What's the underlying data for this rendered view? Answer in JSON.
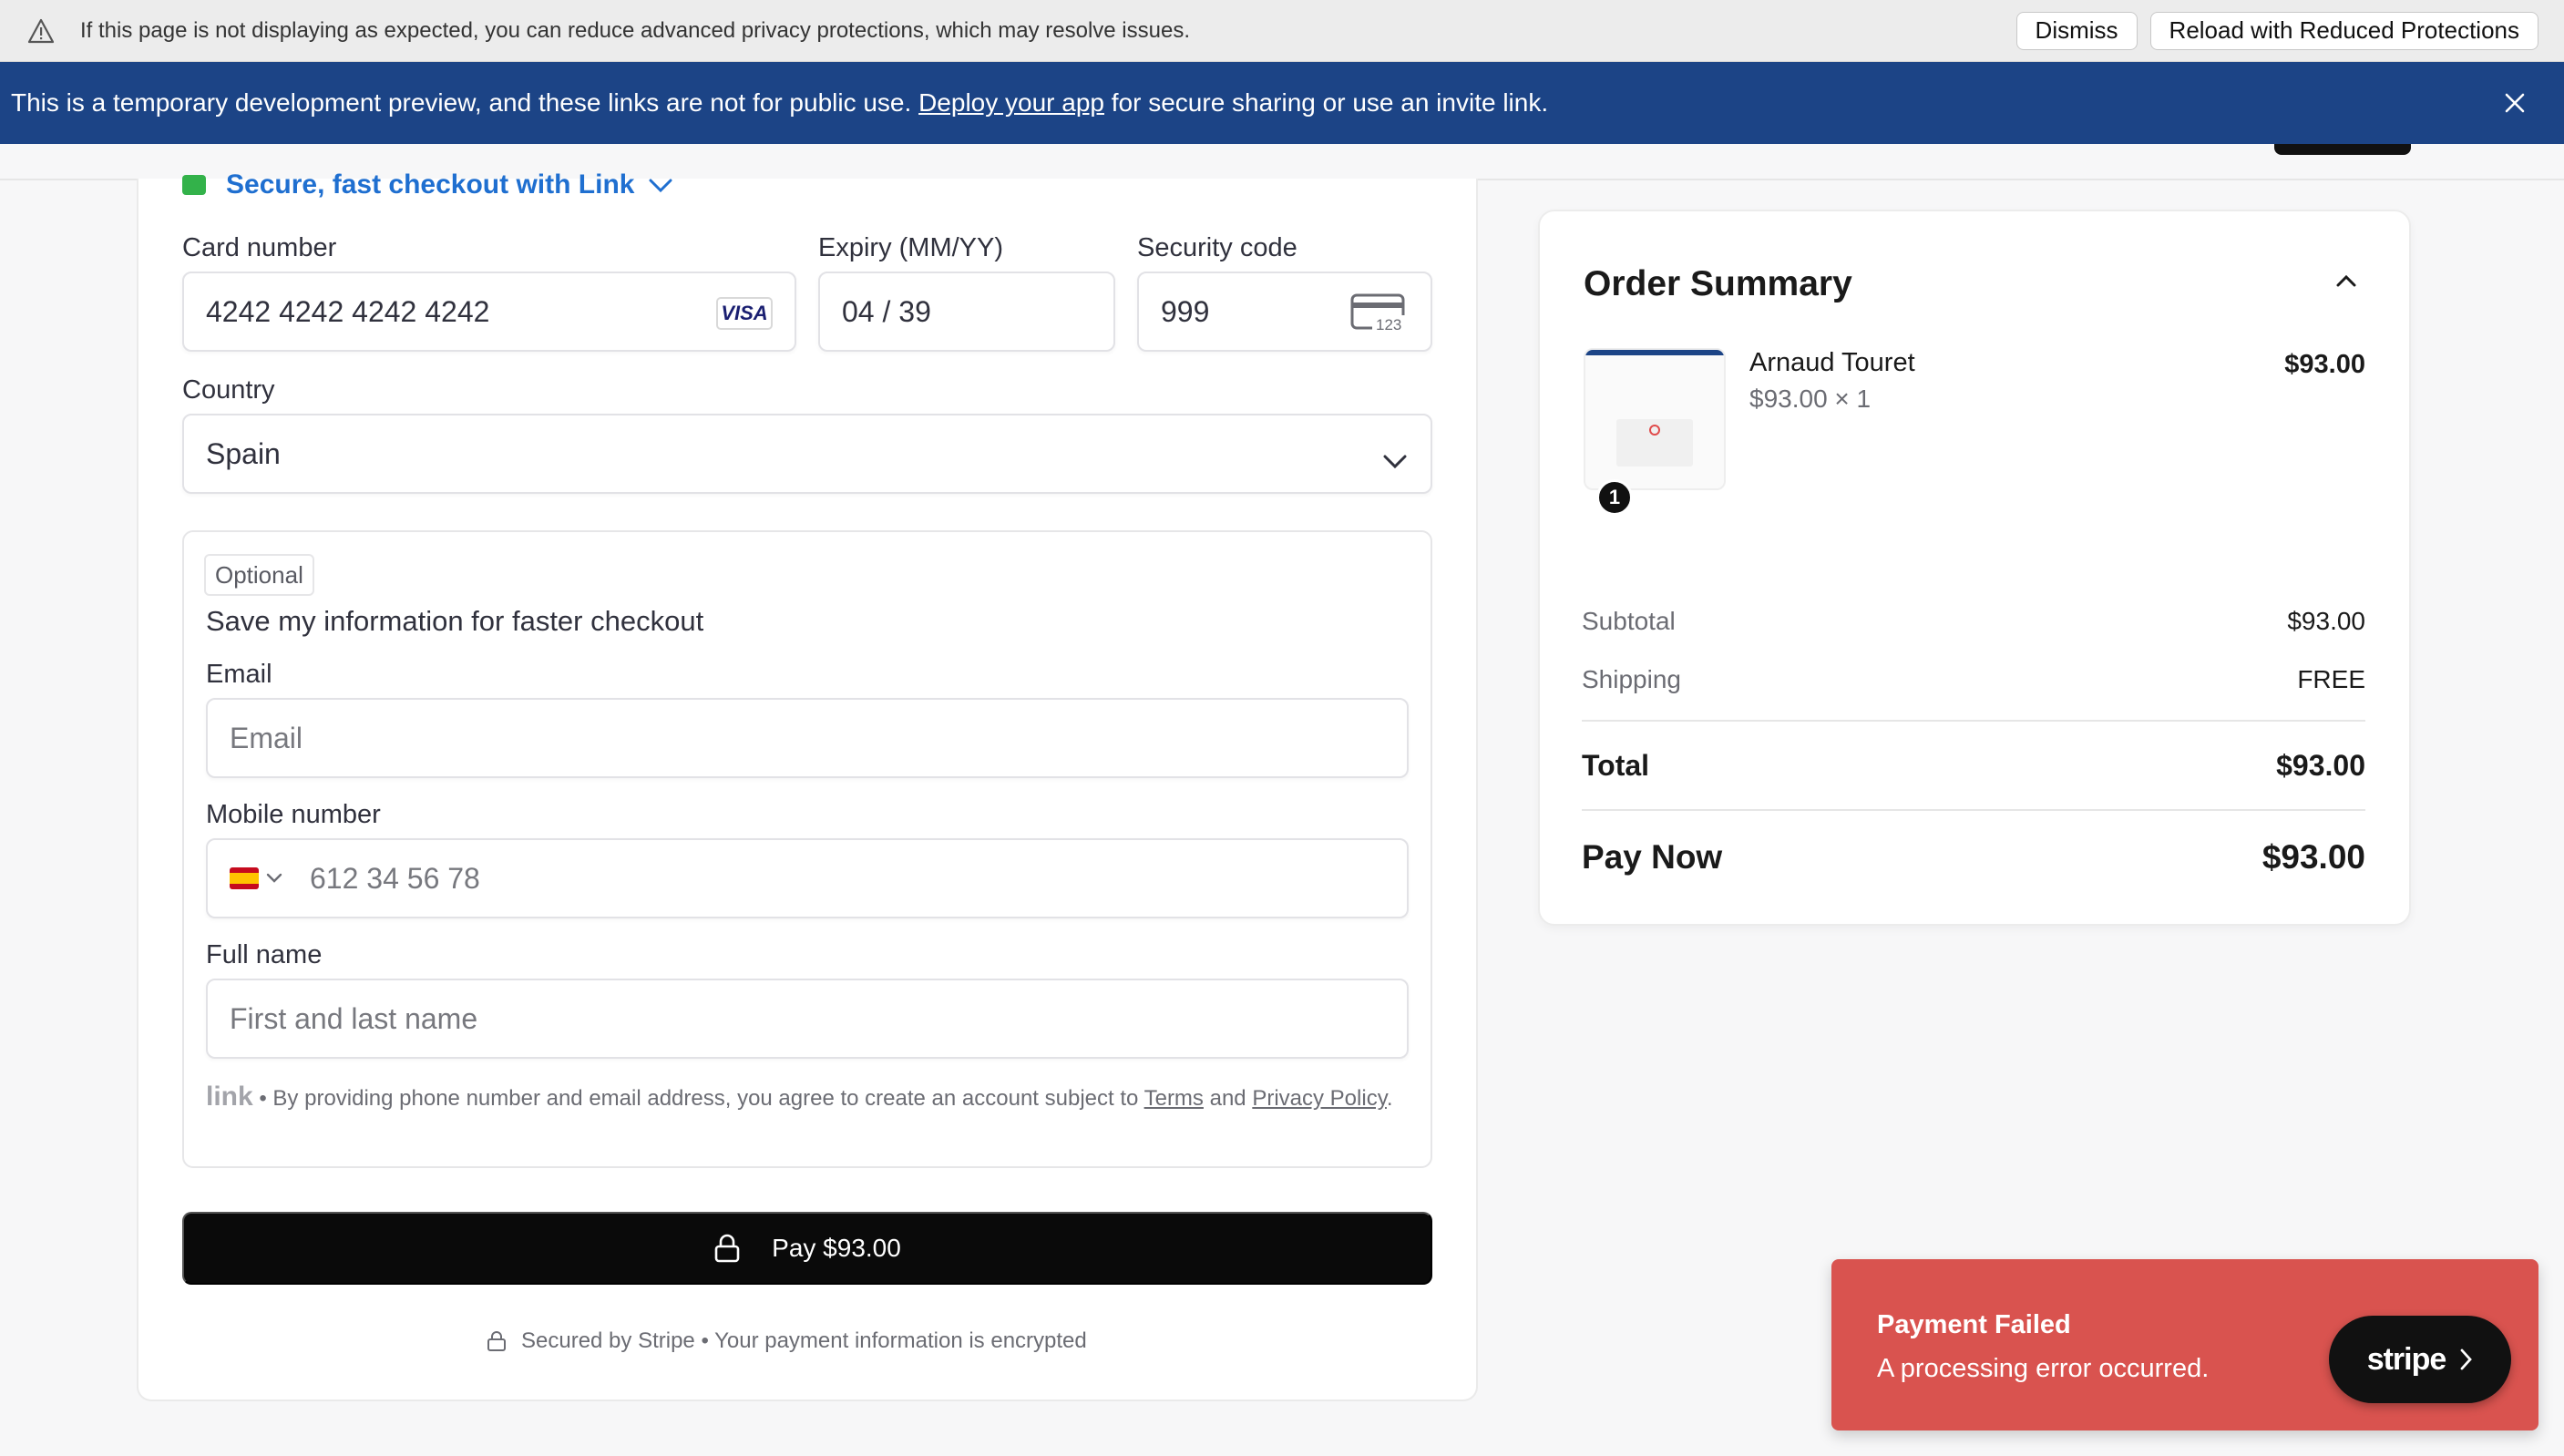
{
  "privacy_bar": {
    "message": "If this page is not displaying as expected, you can reduce advanced privacy protections, which may resolve issues.",
    "dismiss_label": "Dismiss",
    "reload_label": "Reload with Reduced Protections"
  },
  "dev_banner": {
    "text_before": "This is a temporary development preview, and these links are not for public use.",
    "link_text": "Deploy your app",
    "text_after": "for secure sharing or use an invite link."
  },
  "checkout": {
    "link_header": "Secure, fast checkout with Link",
    "card_number_label": "Card number",
    "card_number_value": "4242 4242 4242 4242",
    "card_brand": "VISA",
    "expiry_label": "Expiry (MM/YY)",
    "expiry_value": "04 / 39",
    "security_label": "Security code",
    "security_value": "999",
    "cvc_hint": "123",
    "country_label": "Country",
    "country_value": "Spain",
    "optional_tag": "Optional",
    "save_title": "Save my information for faster checkout",
    "email_label": "Email",
    "email_placeholder": "Email",
    "mobile_label": "Mobile number",
    "mobile_placeholder": "612 34 56 78",
    "fullname_label": "Full name",
    "fullname_placeholder": "First and last name",
    "legal_logo": "link",
    "legal_text": " • By providing phone number and email address, you agree to create an account subject to ",
    "terms_link": "Terms",
    "legal_and": " and ",
    "privacy_link": "Privacy Policy",
    "legal_end": ".",
    "pay_button": "Pay $93.00",
    "secured_text": "Secured by Stripe • Your payment information is encrypted"
  },
  "summary": {
    "title": "Order Summary",
    "item_name": "Arnaud Touret",
    "item_sub": "$93.00 × 1",
    "item_price": "$93.00",
    "item_qty": "1",
    "subtotal_label": "Subtotal",
    "subtotal_value": "$93.00",
    "shipping_label": "Shipping",
    "shipping_value": "FREE",
    "total_label": "Total",
    "total_value": "$93.00",
    "paynow_label": "Pay Now",
    "paynow_value": "$93.00"
  },
  "toast": {
    "title": "Payment Failed",
    "message": "A processing error occurred.",
    "brand": "stripe"
  },
  "colors": {
    "banner_blue": "#1c4486",
    "link_blue": "#1f6fd0",
    "toast_red": "#d9534f"
  },
  "icons": [
    "warning-icon",
    "close-icon",
    "lock-icon",
    "chevron-down-icon",
    "chevron-up-icon",
    "card-icon",
    "spain-flag-icon",
    "chevron-right-icon"
  ]
}
